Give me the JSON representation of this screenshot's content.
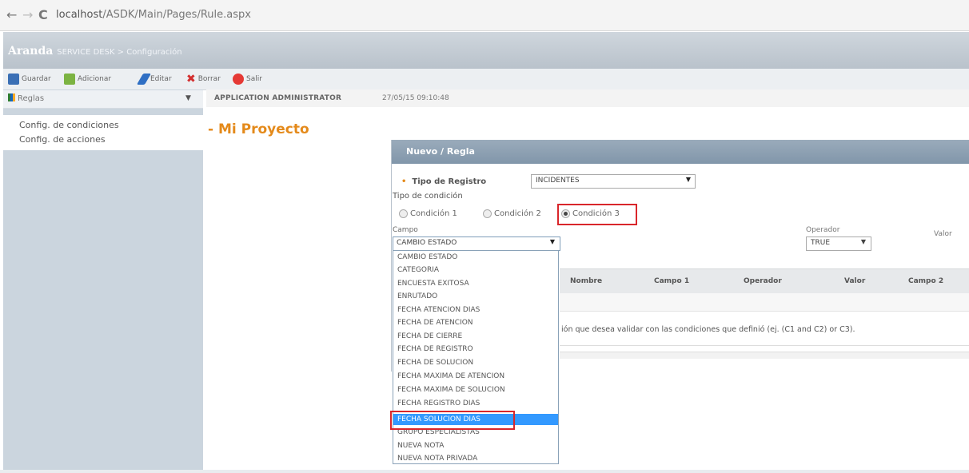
{
  "browser": {
    "back": "←",
    "forward": "→",
    "reload": "C",
    "url_host": "localhost",
    "url_path": "/ASDK/Main/Pages/Rule.aspx"
  },
  "app": {
    "brand": "Aranda",
    "subtitle": "SERVICE DESK > Configuración"
  },
  "toolbar": {
    "save": "Guardar",
    "add": "Adicionar",
    "edit": "Editar",
    "delete": "Borrar",
    "exit": "Salir"
  },
  "sidebar": {
    "title": "Reglas",
    "items": [
      "Config. de condiciones",
      "Config. de acciones"
    ]
  },
  "session": {
    "user": "APPLICATION ADMINISTRATOR",
    "datetime": "27/05/15 09:10:48"
  },
  "project_title": "- Mi Proyecto",
  "modal": {
    "title": "Nuevo / Regla",
    "tipo_registro_label": "Tipo de Registro",
    "tipo_registro_value": "INCIDENTES",
    "tipo_condicion_label": "Tipo de condición",
    "conditions": [
      "Condición 1",
      "Condición 2",
      "Condición 3"
    ],
    "selected_condition": "Condición 3",
    "campo_label": "Campo",
    "campo_value": "CAMBIO ESTADO",
    "operador_label": "Operador",
    "operador_value": "TRUE",
    "valor_label": "Valor",
    "grid_columns": [
      "Nombre",
      "Campo 1",
      "Operador",
      "Valor",
      "Campo 2"
    ],
    "hint": "ión que desea validar con las condiciones que definió (ej. (C1 and C2) or C3)."
  },
  "dropdown": {
    "options": [
      "CAMBIO ESTADO",
      "CATEGORIA",
      "ENCUESTA EXITOSA",
      "ENRUTADO",
      "FECHA ATENCION DIAS",
      "FECHA DE ATENCION",
      "FECHA DE CIERRE",
      "FECHA DE REGISTRO",
      "FECHA DE SOLUCION",
      "FECHA MAXIMA DE ATENCION",
      "FECHA MAXIMA DE SOLUCION",
      "FECHA REGISTRO DIAS",
      "FECHA SOLUCION DIAS",
      "GRUPO ESPECIALISTAS",
      "NUEVA NOTA",
      "NUEVA NOTA PRIVADA"
    ],
    "highlighted": "FECHA SOLUCION DIAS"
  },
  "colors": {
    "accent_orange": "#e48a1b",
    "highlight_red": "#d9262b",
    "selection_blue": "#3399ff",
    "header_blue": "#8196aa"
  }
}
